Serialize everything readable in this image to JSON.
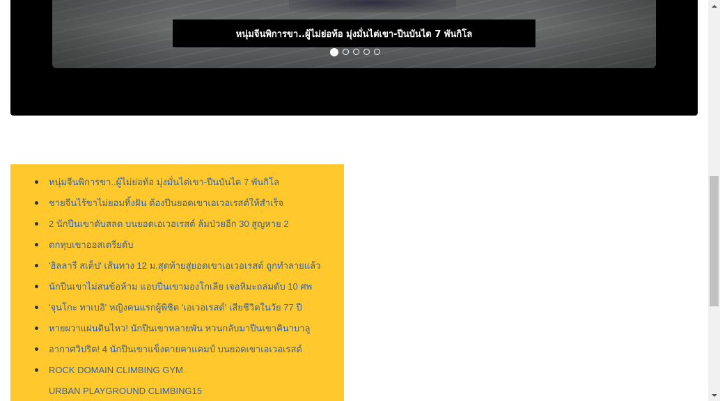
{
  "slider": {
    "caption": "หนุ่มจีนพิการขา..ผู้ไม่ย่อท้อ มุ่งมั่นไต่เขา-ปีนบันได 7 พันกิโล",
    "dots": [
      true,
      false,
      false,
      false,
      false
    ]
  },
  "links": {
    "items": [
      {
        "label": "หนุ่มจีนพิการขา..ผู้ไม่ย่อท้อ มุ่งมั่นไต่เขา-ปีนบันได 7 พันกิโล",
        "bullet": true
      },
      {
        "label": "ชายจีนไร้ขาไม่ยอมทิ้งฝัน ต้องปีนยอดเขาเอเวอเรสต์ให้สำเร็จ",
        "bullet": true
      },
      {
        "label": "2 นักปีนเขาดับสลด บนยอดเอเวอเรสต์ ล้มป่วยอีก 30 สูญหาย 2",
        "bullet": true
      },
      {
        "label": "ตกหุบเขาออสเตรียดับ",
        "bullet": true
      },
      {
        "label": "'ฮิลลารี สเต็ป' เส้นทาง 12 ม.สุดท้ายสู่ยอดเขาเอเวอเรสต์ ถูกทำลายแล้ว",
        "bullet": true
      },
      {
        "label": "นักปีนเขาไม่สนข้อห้าม แอบปีนเขามองโกเลีย เจอหิมะถล่มดับ 10 ศพ",
        "bullet": true
      },
      {
        "label": "'จุนโกะ ทาเบอิ' หญิงคนแรกผู้พิชิต 'เอเวอเรสต์' เสียชีวิตในวัย 77 ปี",
        "bullet": true
      },
      {
        "label": "หายผวาแผ่นดินไหว! นักปีนเขาหลายพัน หวนกลับมาปีนเขาคินาบาลู",
        "bullet": true
      },
      {
        "label": "อากาศวิปริต! 4 นักปีนเขาแข็งตายคาแคมป์ บนยอดเขาเอเวอเรสต์",
        "bullet": true
      },
      {
        "label": "ROCK DOMAIN CLIMBING GYM",
        "bullet": true
      },
      {
        "label": "URBAN PLAYGROUND CLIMBING15",
        "bullet": false
      }
    ]
  },
  "colors": {
    "slider_bg": "#000000",
    "list_bg": "#ffc82c",
    "link": "#2d62b8"
  }
}
